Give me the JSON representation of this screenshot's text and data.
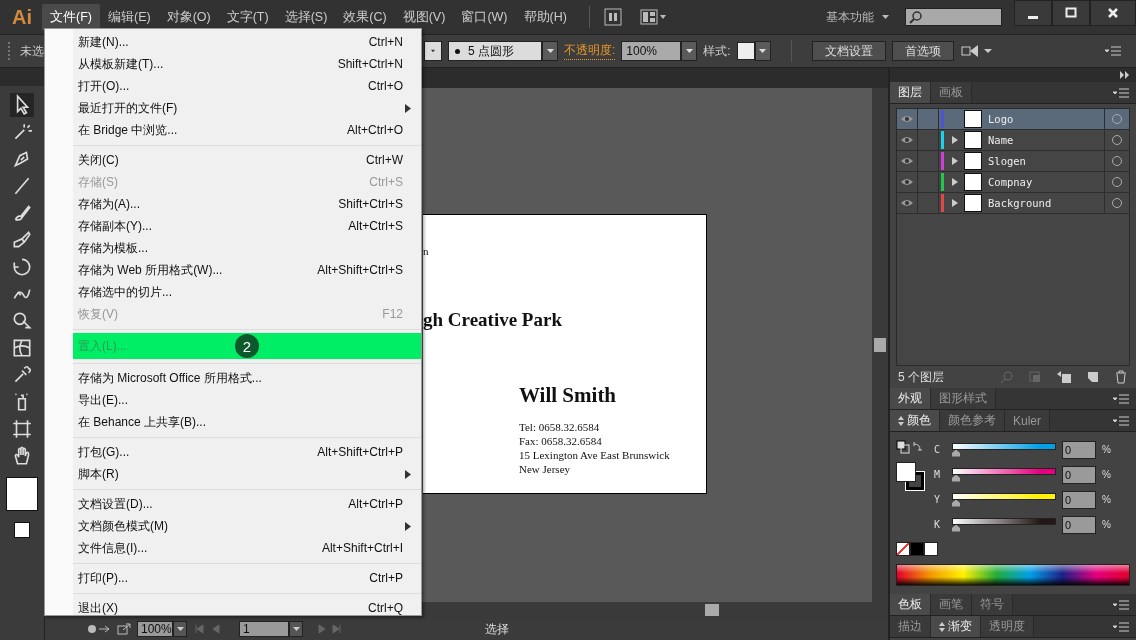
{
  "app": {
    "logo": "Ai"
  },
  "menu_bar": [
    {
      "label": "文件(F)",
      "selected": true
    },
    {
      "label": "编辑(E)",
      "selected": false
    },
    {
      "label": "对象(O)",
      "selected": false
    },
    {
      "label": "文字(T)",
      "selected": false
    },
    {
      "label": "选择(S)",
      "selected": false
    },
    {
      "label": "效果(C)",
      "selected": false
    },
    {
      "label": "视图(V)",
      "selected": false
    },
    {
      "label": "窗口(W)",
      "selected": false
    },
    {
      "label": "帮助(H)",
      "selected": false
    }
  ],
  "workspace": {
    "label": "基本功能"
  },
  "control_bar": {
    "selection_label": "未选",
    "brush": "5 点圆形",
    "opacity_label": "不透明度:",
    "opacity": "100%",
    "style_label": "样式:",
    "buttons": [
      "文档设置",
      "首选项"
    ]
  },
  "file_menu": {
    "groups": [
      [
        {
          "label": "新建(N)...",
          "shortcut": "Ctrl+N",
          "disabled": false,
          "submenu": false,
          "selected": false
        },
        {
          "label": "从模板新建(T)...",
          "shortcut": "Shift+Ctrl+N",
          "disabled": false,
          "submenu": false,
          "selected": false
        },
        {
          "label": "打开(O)...",
          "shortcut": "Ctrl+O",
          "disabled": false,
          "submenu": false,
          "selected": false
        },
        {
          "label": "最近打开的文件(F)",
          "disabled": false,
          "submenu": true,
          "selected": false
        },
        {
          "label": "在 Bridge 中浏览...",
          "shortcut": "Alt+Ctrl+O",
          "disabled": false,
          "submenu": false,
          "selected": false
        }
      ],
      [
        {
          "label": "关闭(C)",
          "shortcut": "Ctrl+W",
          "disabled": false,
          "submenu": false,
          "selected": false
        },
        {
          "label": "存储(S)",
          "shortcut": "Ctrl+S",
          "disabled": true,
          "submenu": false,
          "selected": false
        },
        {
          "label": "存储为(A)...",
          "shortcut": "Shift+Ctrl+S",
          "disabled": false,
          "submenu": false,
          "selected": false
        },
        {
          "label": "存储副本(Y)...",
          "shortcut": "Alt+Ctrl+S",
          "disabled": false,
          "submenu": false,
          "selected": false
        },
        {
          "label": "存储为模板...",
          "disabled": false,
          "submenu": false,
          "selected": false
        },
        {
          "label": "存储为 Web 所用格式(W)...",
          "shortcut": "Alt+Shift+Ctrl+S",
          "disabled": false,
          "submenu": false,
          "selected": false
        },
        {
          "label": "存储选中的切片...",
          "disabled": false,
          "submenu": false,
          "selected": false
        },
        {
          "label": "恢复(V)",
          "shortcut": "F12",
          "disabled": true,
          "submenu": false,
          "selected": false
        }
      ],
      [
        {
          "label": "置入(L)...",
          "disabled": false,
          "submenu": false,
          "selected": true,
          "badge": "2"
        }
      ],
      [
        {
          "label": "存储为 Microsoft Office 所用格式...",
          "disabled": false,
          "submenu": false,
          "selected": false
        },
        {
          "label": "导出(E)...",
          "disabled": false,
          "submenu": false,
          "selected": false
        },
        {
          "label": "在 Behance 上共享(B)...",
          "disabled": false,
          "submenu": false,
          "selected": false
        }
      ],
      [
        {
          "label": "打包(G)...",
          "shortcut": "Alt+Shift+Ctrl+P",
          "disabled": false,
          "submenu": false,
          "selected": false
        },
        {
          "label": "脚本(R)",
          "disabled": false,
          "submenu": true,
          "selected": false
        }
      ],
      [
        {
          "label": "文档设置(D)...",
          "shortcut": "Alt+Ctrl+P",
          "disabled": false,
          "submenu": false,
          "selected": false
        },
        {
          "label": "文档颜色模式(M)",
          "disabled": false,
          "submenu": true,
          "selected": false
        },
        {
          "label": "文件信息(I)...",
          "shortcut": "Alt+Shift+Ctrl+I",
          "disabled": false,
          "submenu": false,
          "selected": false
        }
      ],
      [
        {
          "label": "打印(P)...",
          "shortcut": "Ctrl+P",
          "disabled": false,
          "submenu": false,
          "selected": false
        }
      ],
      [
        {
          "label": "退出(X)",
          "shortcut": "Ctrl+Q",
          "disabled": false,
          "submenu": false,
          "selected": false
        }
      ]
    ]
  },
  "artboard": {
    "texts": [
      {
        "kind": "small",
        "text": "n"
      },
      {
        "kind": "title",
        "text": "gh Creative Park"
      },
      {
        "kind": "name",
        "text": "Will Smith"
      },
      {
        "kind": "line",
        "text": "Tel: 0658.32.6584"
      },
      {
        "kind": "line",
        "text": "Fax: 0658.32.6584"
      },
      {
        "kind": "line",
        "text": "15 Lexington Ave East Brunswick"
      },
      {
        "kind": "line",
        "text": "New Jersey"
      }
    ]
  },
  "layers_panel": {
    "tabs": [
      {
        "label": "图层",
        "selected": true
      },
      {
        "label": "画板",
        "selected": false
      }
    ],
    "layers": [
      {
        "name": "Logo",
        "visible": true,
        "color": "#4b55d6",
        "expandable": false,
        "selected": true
      },
      {
        "name": "Name",
        "visible": true,
        "color": "#18d4e6",
        "expandable": true,
        "selected": false
      },
      {
        "name": "Slogen",
        "visible": true,
        "color": "#d03cd8",
        "expandable": true,
        "selected": false
      },
      {
        "name": "Compnay",
        "visible": true,
        "color": "#22c84a",
        "expandable": true,
        "selected": false
      },
      {
        "name": "Background",
        "visible": true,
        "color": "#e04848",
        "expandable": true,
        "selected": false
      }
    ],
    "count": "5 个图层"
  },
  "appearance_tabs": [
    {
      "label": "外观",
      "selected": true,
      "collapsible": false
    },
    {
      "label": "图形样式",
      "selected": false,
      "collapsible": false
    }
  ],
  "color_tabs": [
    {
      "label": "颜色",
      "selected": true,
      "collapsible": true
    },
    {
      "label": "颜色参考",
      "selected": false,
      "collapsible": false
    },
    {
      "label": "Kuler",
      "selected": false,
      "collapsible": false
    }
  ],
  "color_channels": [
    {
      "name": "C",
      "color": "#00a0e9",
      "level": 0,
      "value": "0",
      "unit": "%"
    },
    {
      "name": "M",
      "color": "#e4007f",
      "level": 0,
      "value": "0",
      "unit": "%"
    },
    {
      "name": "Y",
      "color": "#fff100",
      "level": 0,
      "value": "0",
      "unit": "%"
    },
    {
      "name": "K",
      "color": "#231815",
      "level": 0,
      "value": "0",
      "unit": "%"
    }
  ],
  "swatch_tabs": [
    {
      "label": "色板",
      "selected": true,
      "collapsible": false
    },
    {
      "label": "画笔",
      "selected": false,
      "collapsible": false
    },
    {
      "label": "符号",
      "selected": false,
      "collapsible": false
    }
  ],
  "stroke_tabs": [
    {
      "label": "描边",
      "selected": false,
      "collapsible": false
    },
    {
      "label": "渐变",
      "selected": true,
      "collapsible": true
    },
    {
      "label": "透明度",
      "selected": false,
      "collapsible": false
    }
  ],
  "status_bar": {
    "zoom": "100%",
    "page": "1",
    "tool": "选择"
  }
}
